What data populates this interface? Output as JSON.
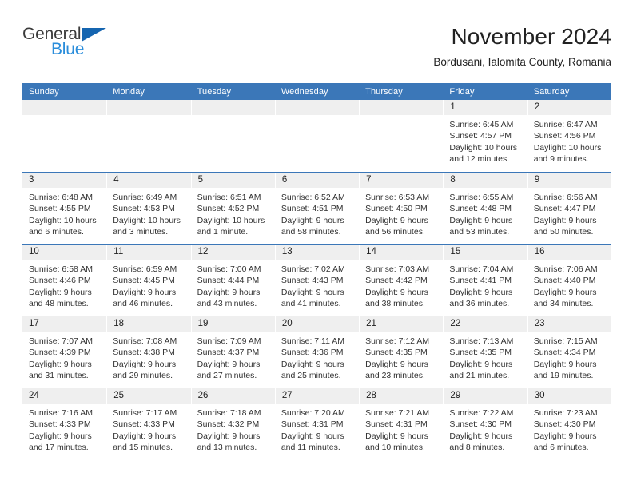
{
  "brand": {
    "line1": "General",
    "line2": "Blue",
    "accent_dark": "#1565b0",
    "accent_light": "#2a8ddb"
  },
  "header": {
    "title": "November 2024",
    "subtitle": "Bordusani, Ialomita County, Romania"
  },
  "theme": {
    "header_blue": "#3b77b8",
    "day_band_gray": "#efefef",
    "text": "#222222"
  },
  "weekdays": [
    "Sunday",
    "Monday",
    "Tuesday",
    "Wednesday",
    "Thursday",
    "Friday",
    "Saturday"
  ],
  "labels": {
    "sunrise_prefix": "Sunrise:",
    "sunset_prefix": "Sunset:",
    "daylight_prefix": "Daylight:"
  },
  "weeks": [
    [
      {
        "day": "",
        "empty": true
      },
      {
        "day": "",
        "empty": true
      },
      {
        "day": "",
        "empty": true
      },
      {
        "day": "",
        "empty": true
      },
      {
        "day": "",
        "empty": true
      },
      {
        "day": "1",
        "sunrise": "Sunrise: 6:45 AM",
        "sunset": "Sunset: 4:57 PM",
        "daylight": "Daylight: 10 hours and 12 minutes."
      },
      {
        "day": "2",
        "sunrise": "Sunrise: 6:47 AM",
        "sunset": "Sunset: 4:56 PM",
        "daylight": "Daylight: 10 hours and 9 minutes."
      }
    ],
    [
      {
        "day": "3",
        "sunrise": "Sunrise: 6:48 AM",
        "sunset": "Sunset: 4:55 PM",
        "daylight": "Daylight: 10 hours and 6 minutes."
      },
      {
        "day": "4",
        "sunrise": "Sunrise: 6:49 AM",
        "sunset": "Sunset: 4:53 PM",
        "daylight": "Daylight: 10 hours and 3 minutes."
      },
      {
        "day": "5",
        "sunrise": "Sunrise: 6:51 AM",
        "sunset": "Sunset: 4:52 PM",
        "daylight": "Daylight: 10 hours and 1 minute."
      },
      {
        "day": "6",
        "sunrise": "Sunrise: 6:52 AM",
        "sunset": "Sunset: 4:51 PM",
        "daylight": "Daylight: 9 hours and 58 minutes."
      },
      {
        "day": "7",
        "sunrise": "Sunrise: 6:53 AM",
        "sunset": "Sunset: 4:50 PM",
        "daylight": "Daylight: 9 hours and 56 minutes."
      },
      {
        "day": "8",
        "sunrise": "Sunrise: 6:55 AM",
        "sunset": "Sunset: 4:48 PM",
        "daylight": "Daylight: 9 hours and 53 minutes."
      },
      {
        "day": "9",
        "sunrise": "Sunrise: 6:56 AM",
        "sunset": "Sunset: 4:47 PM",
        "daylight": "Daylight: 9 hours and 50 minutes."
      }
    ],
    [
      {
        "day": "10",
        "sunrise": "Sunrise: 6:58 AM",
        "sunset": "Sunset: 4:46 PM",
        "daylight": "Daylight: 9 hours and 48 minutes."
      },
      {
        "day": "11",
        "sunrise": "Sunrise: 6:59 AM",
        "sunset": "Sunset: 4:45 PM",
        "daylight": "Daylight: 9 hours and 46 minutes."
      },
      {
        "day": "12",
        "sunrise": "Sunrise: 7:00 AM",
        "sunset": "Sunset: 4:44 PM",
        "daylight": "Daylight: 9 hours and 43 minutes."
      },
      {
        "day": "13",
        "sunrise": "Sunrise: 7:02 AM",
        "sunset": "Sunset: 4:43 PM",
        "daylight": "Daylight: 9 hours and 41 minutes."
      },
      {
        "day": "14",
        "sunrise": "Sunrise: 7:03 AM",
        "sunset": "Sunset: 4:42 PM",
        "daylight": "Daylight: 9 hours and 38 minutes."
      },
      {
        "day": "15",
        "sunrise": "Sunrise: 7:04 AM",
        "sunset": "Sunset: 4:41 PM",
        "daylight": "Daylight: 9 hours and 36 minutes."
      },
      {
        "day": "16",
        "sunrise": "Sunrise: 7:06 AM",
        "sunset": "Sunset: 4:40 PM",
        "daylight": "Daylight: 9 hours and 34 minutes."
      }
    ],
    [
      {
        "day": "17",
        "sunrise": "Sunrise: 7:07 AM",
        "sunset": "Sunset: 4:39 PM",
        "daylight": "Daylight: 9 hours and 31 minutes."
      },
      {
        "day": "18",
        "sunrise": "Sunrise: 7:08 AM",
        "sunset": "Sunset: 4:38 PM",
        "daylight": "Daylight: 9 hours and 29 minutes."
      },
      {
        "day": "19",
        "sunrise": "Sunrise: 7:09 AM",
        "sunset": "Sunset: 4:37 PM",
        "daylight": "Daylight: 9 hours and 27 minutes."
      },
      {
        "day": "20",
        "sunrise": "Sunrise: 7:11 AM",
        "sunset": "Sunset: 4:36 PM",
        "daylight": "Daylight: 9 hours and 25 minutes."
      },
      {
        "day": "21",
        "sunrise": "Sunrise: 7:12 AM",
        "sunset": "Sunset: 4:35 PM",
        "daylight": "Daylight: 9 hours and 23 minutes."
      },
      {
        "day": "22",
        "sunrise": "Sunrise: 7:13 AM",
        "sunset": "Sunset: 4:35 PM",
        "daylight": "Daylight: 9 hours and 21 minutes."
      },
      {
        "day": "23",
        "sunrise": "Sunrise: 7:15 AM",
        "sunset": "Sunset: 4:34 PM",
        "daylight": "Daylight: 9 hours and 19 minutes."
      }
    ],
    [
      {
        "day": "24",
        "sunrise": "Sunrise: 7:16 AM",
        "sunset": "Sunset: 4:33 PM",
        "daylight": "Daylight: 9 hours and 17 minutes."
      },
      {
        "day": "25",
        "sunrise": "Sunrise: 7:17 AM",
        "sunset": "Sunset: 4:33 PM",
        "daylight": "Daylight: 9 hours and 15 minutes."
      },
      {
        "day": "26",
        "sunrise": "Sunrise: 7:18 AM",
        "sunset": "Sunset: 4:32 PM",
        "daylight": "Daylight: 9 hours and 13 minutes."
      },
      {
        "day": "27",
        "sunrise": "Sunrise: 7:20 AM",
        "sunset": "Sunset: 4:31 PM",
        "daylight": "Daylight: 9 hours and 11 minutes."
      },
      {
        "day": "28",
        "sunrise": "Sunrise: 7:21 AM",
        "sunset": "Sunset: 4:31 PM",
        "daylight": "Daylight: 9 hours and 10 minutes."
      },
      {
        "day": "29",
        "sunrise": "Sunrise: 7:22 AM",
        "sunset": "Sunset: 4:30 PM",
        "daylight": "Daylight: 9 hours and 8 minutes."
      },
      {
        "day": "30",
        "sunrise": "Sunrise: 7:23 AM",
        "sunset": "Sunset: 4:30 PM",
        "daylight": "Daylight: 9 hours and 6 minutes."
      }
    ]
  ]
}
